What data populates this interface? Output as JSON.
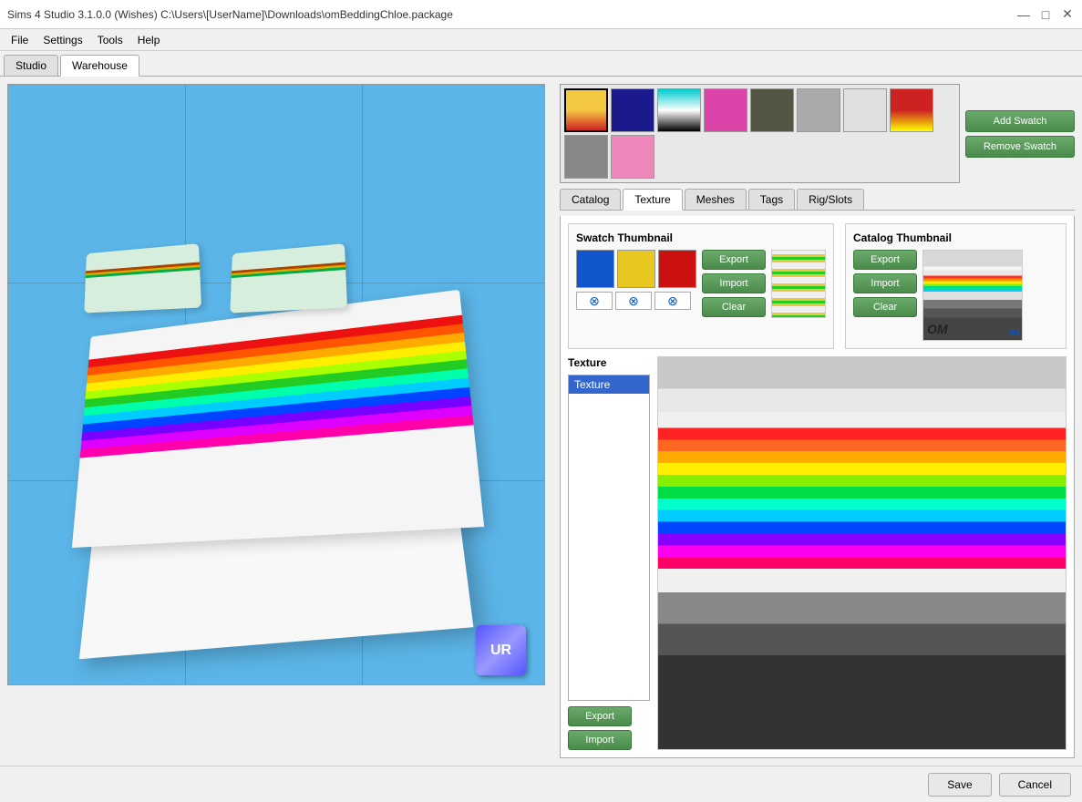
{
  "titlebar": {
    "title": "Sims 4 Studio 3.1.0.0 (Wishes)  C:\\Users\\[UserName]\\Downloads\\omBeddingChloe.package",
    "min_btn": "—",
    "max_btn": "□",
    "close_btn": "✕"
  },
  "menubar": {
    "items": [
      "File",
      "Settings",
      "Tools",
      "Help"
    ]
  },
  "tabs": {
    "main": [
      {
        "label": "Studio",
        "active": false
      },
      {
        "label": "Warehouse",
        "active": true
      }
    ],
    "inner": [
      {
        "label": "Catalog",
        "active": false
      },
      {
        "label": "Texture",
        "active": true
      },
      {
        "label": "Meshes",
        "active": false
      },
      {
        "label": "Tags",
        "active": false
      },
      {
        "label": "Rig/Slots",
        "active": false
      }
    ]
  },
  "swatch_buttons": {
    "add_label": "Add Swatch",
    "remove_label": "Remove Swatch"
  },
  "swatch_thumbnail": {
    "title": "Swatch Thumbnail",
    "export_label": "Export",
    "import_label": "Import",
    "clear_label": "Clear"
  },
  "catalog_thumbnail": {
    "title": "Catalog Thumbnail",
    "export_label": "Export",
    "import_label": "Import",
    "clear_label": "Clear",
    "watermark": "OM",
    "logo": "S4"
  },
  "texture": {
    "title": "Texture",
    "list_item": "Texture",
    "export_label": "Export",
    "import_label": "Import"
  },
  "bottom": {
    "save_label": "Save",
    "cancel_label": "Cancel"
  },
  "nav_cube": {
    "label": "UR"
  }
}
